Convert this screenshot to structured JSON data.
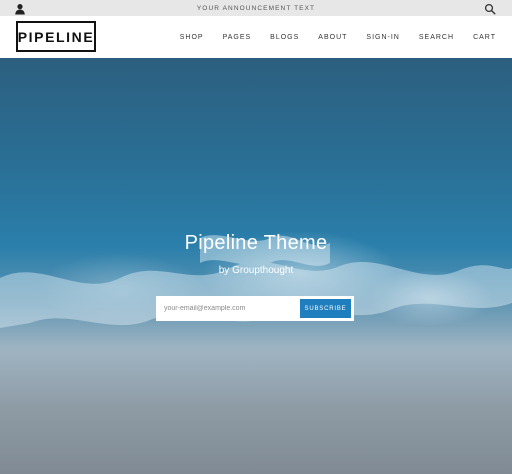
{
  "announcement": {
    "text": "YOUR ANNOUNCEMENT TEXT"
  },
  "header": {
    "logo": "PIPELINE",
    "nav": [
      "SHOP",
      "PAGES",
      "BLOGS",
      "ABOUT",
      "SIGN-IN",
      "SEARCH",
      "CART"
    ]
  },
  "hero": {
    "title": "Pipeline Theme",
    "subtitle": "by Groupthought",
    "email_placeholder": "your-email@example.com",
    "subscribe_label": "SUBSCRIBE"
  },
  "colors": {
    "announcement_bg": "#e6e7e6",
    "accent": "#1f7ebd",
    "ocean_deep": "#2a6f95",
    "sand": "#8d9aa4"
  },
  "icons": [
    "account-icon",
    "search-icon"
  ]
}
